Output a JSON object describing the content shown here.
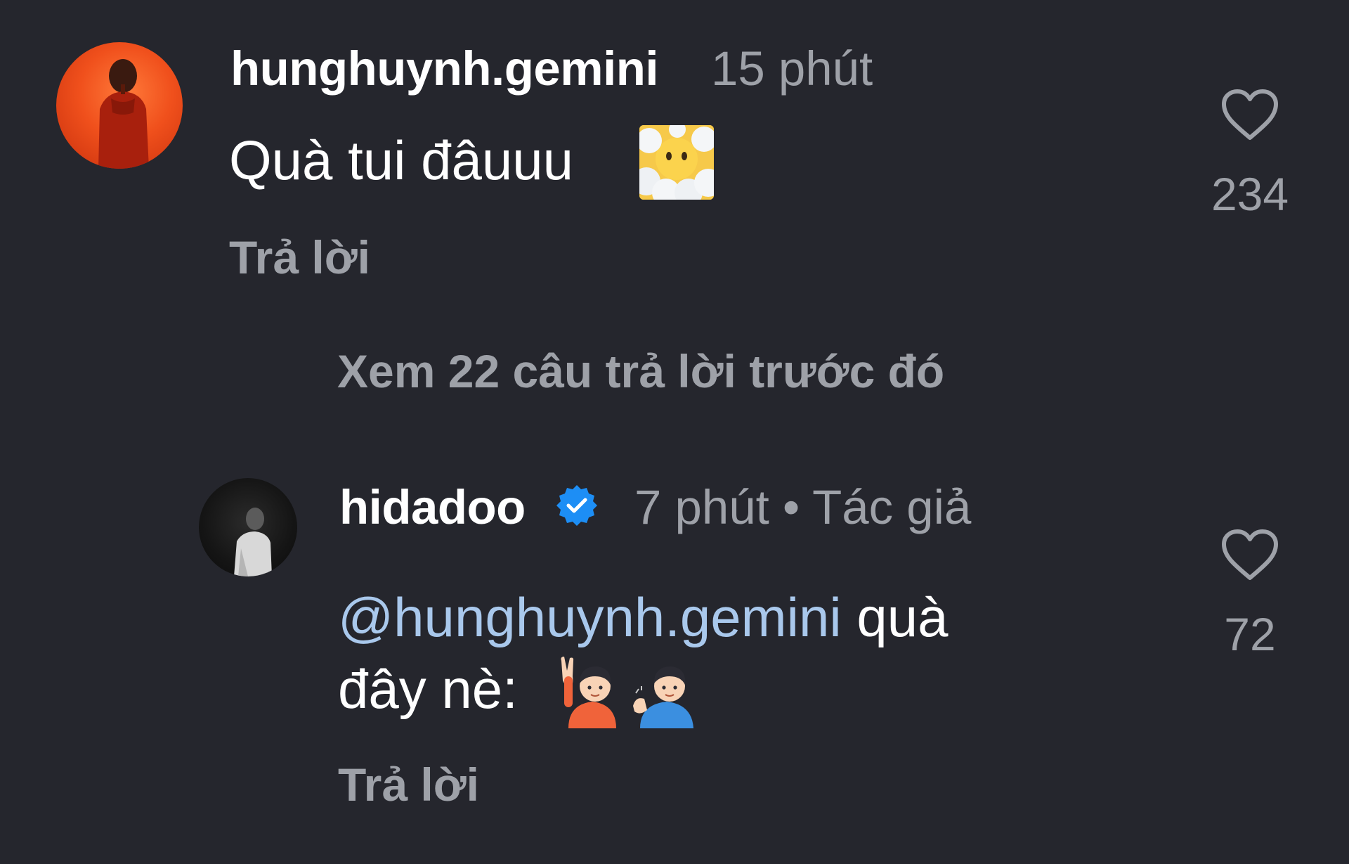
{
  "comment_1": {
    "username": "hunghuynh.gemini",
    "time": "15 phút",
    "text": "Quà tui đâuuu",
    "emoji": "😶‍🌫️",
    "emoji_name": "face-in-clouds",
    "reply_label": "Trả lời",
    "like_count": "234",
    "avatar_icon": "user-avatar"
  },
  "view_previous_replies": "Xem 22 câu trả lời trước đó",
  "comment_2": {
    "username": "hidadoo",
    "verified_icon": "verified-badge-icon",
    "time_and_role": "7 phút • Tác giả",
    "mention": "@hunghuynh.gemini",
    "text_line1_rest": " quà",
    "text_line2": "đây nè: ",
    "emojis": "🙋🏻‍♂️💁🏻‍♂️",
    "reply_label": "Trả lời",
    "like_count": "72"
  },
  "colors": {
    "background": "#25262d",
    "text_primary": "#ffffff",
    "text_secondary": "#9ea1a8",
    "mention": "#a9c8ec",
    "verified_blue": "#1d8ef5"
  }
}
